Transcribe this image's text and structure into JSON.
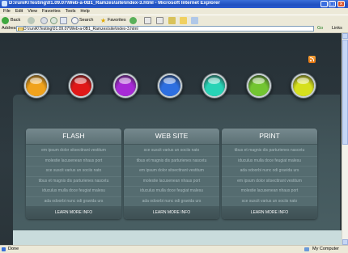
{
  "window": {
    "title": "D:\\runiK\\Testing\\01.09.07\\Web-a-0B1_Ramzes\\site\\index-3.html - Microsoft Internet Explorer"
  },
  "menu": [
    "File",
    "Edit",
    "View",
    "Favorites",
    "Tools",
    "Help"
  ],
  "toolbar": {
    "back": "Back",
    "search": "Search",
    "favorites": "Favorites"
  },
  "address": {
    "label": "Address",
    "value": "D:\\runiK\\Testing\\01.09.07\\Web-a-0B1_Ramzes\\site\\index-3.html",
    "go": "Go",
    "links": "Links"
  },
  "status": {
    "left": "Done",
    "right": "My Computer"
  },
  "page": {
    "ball_colors": [
      "#f0a21c",
      "#e01818",
      "#a72ad6",
      "#2d6fe0",
      "#28d3b6",
      "#72c531",
      "#d6e01e"
    ],
    "columns": [
      {
        "title": "FLASH",
        "lines": [
          "em ipsum dolor sitsecttrant vestitum",
          "molestie lacusenean nhaus port",
          "sce suscit varius un sociis nato",
          "tibus et magnis dis parturienes nascetu",
          "iduculus mulla doce feugiat malesu",
          "ada odoorbi nunc odi gravida urs"
        ],
        "button": "LEARN MORE INFO"
      },
      {
        "title": "WEB SITE",
        "lines": [
          "sce suscit varius un sociis nato",
          "tibus et magnis dis parturienes nascetu",
          "em ipsum dolor sitsecttrant vestitum",
          "molestie lacusenean nhaus port",
          "iduculus mulla doce feugiat malesu",
          "ada odoorbi nunc odi gravida urs"
        ],
        "button": "LEARN MORE INFO"
      },
      {
        "title": "PRINT",
        "lines": [
          "tibus et magnis dis parturienes nascetu",
          "iduculus mulla doce feugiat malesu",
          "ada odoorbi nunc odi gravida urs",
          "em ipsum dolor sitsecttrant vestitum",
          "molestie lacusenean nhaus port",
          "sce suscit varius un sociis nato"
        ],
        "button": "LEARN MORE INFO"
      }
    ]
  }
}
